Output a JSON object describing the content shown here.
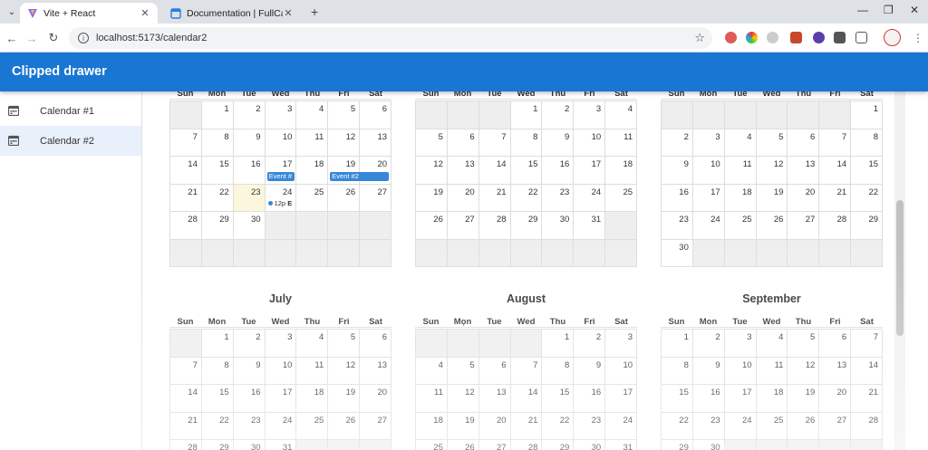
{
  "browser": {
    "tabs": [
      {
        "label": "Vite + React",
        "active": true
      },
      {
        "label": "Documentation | FullCalendar",
        "active": false
      }
    ],
    "url": "localhost:5173/calendar2"
  },
  "app": {
    "title": "Clipped drawer",
    "accent": "#1976d2",
    "nav": [
      {
        "label": "Calendar #1",
        "icon": "calendar-icon",
        "selected": false
      },
      {
        "label": "Calendar #2",
        "icon": "calendar-icon",
        "selected": true
      }
    ]
  },
  "weekdays": [
    "Sun",
    "Mon",
    "Tue",
    "Wed",
    "Thu",
    "Fri",
    "Sat"
  ],
  "weekdays_aug": [
    "Sun",
    "Mọn",
    "Tue",
    "Wed",
    "Thu",
    "Fri",
    "Sat"
  ],
  "months": [
    {
      "title": "",
      "offset": 1,
      "days": 30,
      "weeks": 6,
      "today": 23
    },
    {
      "title": "",
      "offset": 3,
      "days": 31,
      "weeks": 6
    },
    {
      "title": "",
      "offset": 6,
      "days": 30,
      "weeks": 6
    },
    {
      "title": "July",
      "offset": 1,
      "days": 31,
      "weeks": 5
    },
    {
      "title": "August",
      "offset": 4,
      "days": 31,
      "weeks": 5
    },
    {
      "title": "September",
      "offset": 0,
      "days": 30,
      "weeks": 5
    }
  ],
  "events": [
    {
      "label": "Event #",
      "month": 0,
      "start": 17,
      "end": 17
    },
    {
      "label": "Event #2",
      "month": 0,
      "start": 19,
      "end": 20
    },
    {
      "time": "12p",
      "label": "E",
      "month": 0,
      "day": 24
    }
  ]
}
